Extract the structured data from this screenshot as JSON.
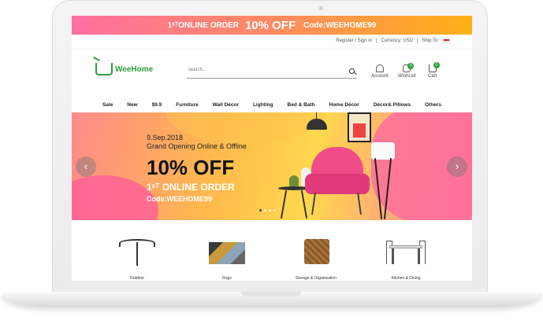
{
  "promo": {
    "line1": "1ˢᵀONLINE ORDER",
    "line2": "10% OFF",
    "line3": "Code:WEEHOME99"
  },
  "utility": {
    "register": "Register / Sign in",
    "currency": "Currency:  USD",
    "ship": "Ship To:"
  },
  "header": {
    "logo": "WeeHome",
    "search_placeholder": "search...",
    "account": "Account",
    "wishlist": "WishList",
    "wishlist_count": "0",
    "cart": "Cart",
    "cart_count": "0"
  },
  "nav": {
    "items": [
      "Sale",
      "New",
      "$9.9",
      "Furniture",
      "Wall Décor",
      "Lighting",
      "Bed & Bath",
      "Home Décor",
      "Décor& Pillows",
      "Others"
    ]
  },
  "banner": {
    "date": "9.Sep.2018",
    "subtitle": "Grand Opening Online & Offline",
    "headline": "10% OFF",
    "order": "1ˢᵀ ONLINE ORDER",
    "code": "Code:WEEHOME99",
    "prev": "‹",
    "next": "›"
  },
  "categories": [
    {
      "label": "Outdoor"
    },
    {
      "label": "Rugs"
    },
    {
      "label": "Storage & Organization"
    },
    {
      "label": "Kitchen & Dining"
    }
  ],
  "colors": {
    "brand_green": "#2e9e3e",
    "promo_pink": "#ff6fa0",
    "promo_orange": "#ffb018"
  }
}
